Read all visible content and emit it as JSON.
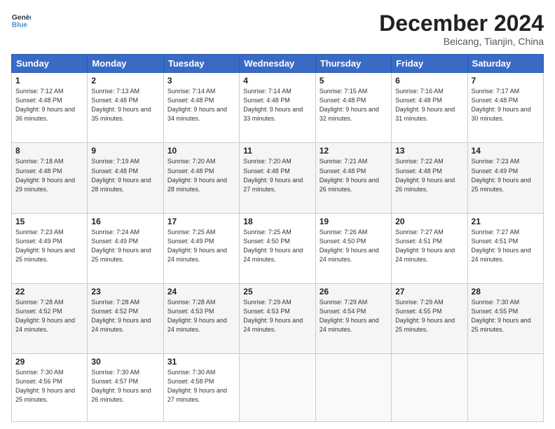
{
  "header": {
    "logo_line1": "General",
    "logo_line2": "Blue",
    "month_year": "December 2024",
    "location": "Beicang, Tianjin, China"
  },
  "days_of_week": [
    "Sunday",
    "Monday",
    "Tuesday",
    "Wednesday",
    "Thursday",
    "Friday",
    "Saturday"
  ],
  "weeks": [
    [
      {
        "day": "1",
        "sunrise": "7:12 AM",
        "sunset": "4:48 PM",
        "daylight": "9 hours and 36 minutes."
      },
      {
        "day": "2",
        "sunrise": "7:13 AM",
        "sunset": "4:48 PM",
        "daylight": "9 hours and 35 minutes."
      },
      {
        "day": "3",
        "sunrise": "7:14 AM",
        "sunset": "4:48 PM",
        "daylight": "9 hours and 34 minutes."
      },
      {
        "day": "4",
        "sunrise": "7:14 AM",
        "sunset": "4:48 PM",
        "daylight": "9 hours and 33 minutes."
      },
      {
        "day": "5",
        "sunrise": "7:15 AM",
        "sunset": "4:48 PM",
        "daylight": "9 hours and 32 minutes."
      },
      {
        "day": "6",
        "sunrise": "7:16 AM",
        "sunset": "4:48 PM",
        "daylight": "9 hours and 31 minutes."
      },
      {
        "day": "7",
        "sunrise": "7:17 AM",
        "sunset": "4:48 PM",
        "daylight": "9 hours and 30 minutes."
      }
    ],
    [
      {
        "day": "8",
        "sunrise": "7:18 AM",
        "sunset": "4:48 PM",
        "daylight": "9 hours and 29 minutes."
      },
      {
        "day": "9",
        "sunrise": "7:19 AM",
        "sunset": "4:48 PM",
        "daylight": "9 hours and 28 minutes."
      },
      {
        "day": "10",
        "sunrise": "7:20 AM",
        "sunset": "4:48 PM",
        "daylight": "9 hours and 28 minutes."
      },
      {
        "day": "11",
        "sunrise": "7:20 AM",
        "sunset": "4:48 PM",
        "daylight": "9 hours and 27 minutes."
      },
      {
        "day": "12",
        "sunrise": "7:21 AM",
        "sunset": "4:48 PM",
        "daylight": "9 hours and 26 minutes."
      },
      {
        "day": "13",
        "sunrise": "7:22 AM",
        "sunset": "4:48 PM",
        "daylight": "9 hours and 26 minutes."
      },
      {
        "day": "14",
        "sunrise": "7:23 AM",
        "sunset": "4:49 PM",
        "daylight": "9 hours and 25 minutes."
      }
    ],
    [
      {
        "day": "15",
        "sunrise": "7:23 AM",
        "sunset": "4:49 PM",
        "daylight": "9 hours and 25 minutes."
      },
      {
        "day": "16",
        "sunrise": "7:24 AM",
        "sunset": "4:49 PM",
        "daylight": "9 hours and 25 minutes."
      },
      {
        "day": "17",
        "sunrise": "7:25 AM",
        "sunset": "4:49 PM",
        "daylight": "9 hours and 24 minutes."
      },
      {
        "day": "18",
        "sunrise": "7:25 AM",
        "sunset": "4:50 PM",
        "daylight": "9 hours and 24 minutes."
      },
      {
        "day": "19",
        "sunrise": "7:26 AM",
        "sunset": "4:50 PM",
        "daylight": "9 hours and 24 minutes."
      },
      {
        "day": "20",
        "sunrise": "7:27 AM",
        "sunset": "4:51 PM",
        "daylight": "9 hours and 24 minutes."
      },
      {
        "day": "21",
        "sunrise": "7:27 AM",
        "sunset": "4:51 PM",
        "daylight": "9 hours and 24 minutes."
      }
    ],
    [
      {
        "day": "22",
        "sunrise": "7:28 AM",
        "sunset": "4:52 PM",
        "daylight": "9 hours and 24 minutes."
      },
      {
        "day": "23",
        "sunrise": "7:28 AM",
        "sunset": "4:52 PM",
        "daylight": "9 hours and 24 minutes."
      },
      {
        "day": "24",
        "sunrise": "7:28 AM",
        "sunset": "4:53 PM",
        "daylight": "9 hours and 24 minutes."
      },
      {
        "day": "25",
        "sunrise": "7:29 AM",
        "sunset": "4:53 PM",
        "daylight": "9 hours and 24 minutes."
      },
      {
        "day": "26",
        "sunrise": "7:29 AM",
        "sunset": "4:54 PM",
        "daylight": "9 hours and 24 minutes."
      },
      {
        "day": "27",
        "sunrise": "7:29 AM",
        "sunset": "4:55 PM",
        "daylight": "9 hours and 25 minutes."
      },
      {
        "day": "28",
        "sunrise": "7:30 AM",
        "sunset": "4:55 PM",
        "daylight": "9 hours and 25 minutes."
      }
    ],
    [
      {
        "day": "29",
        "sunrise": "7:30 AM",
        "sunset": "4:56 PM",
        "daylight": "9 hours and 25 minutes."
      },
      {
        "day": "30",
        "sunrise": "7:30 AM",
        "sunset": "4:57 PM",
        "daylight": "9 hours and 26 minutes."
      },
      {
        "day": "31",
        "sunrise": "7:30 AM",
        "sunset": "4:58 PM",
        "daylight": "9 hours and 27 minutes."
      },
      null,
      null,
      null,
      null
    ]
  ],
  "labels": {
    "sunrise": "Sunrise:",
    "sunset": "Sunset:",
    "daylight": "Daylight:"
  }
}
